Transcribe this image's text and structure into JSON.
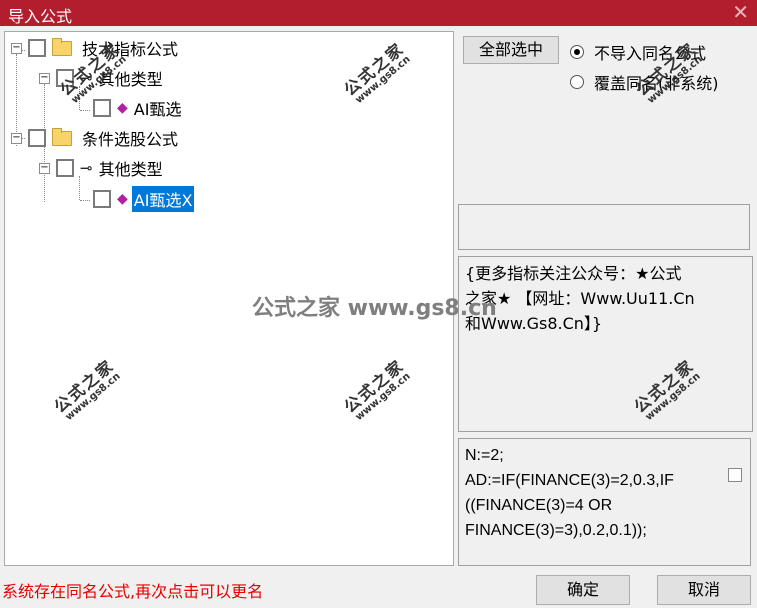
{
  "window": {
    "title": "导入公式",
    "close_glyph": "✕"
  },
  "tree": {
    "n1": "技术指标公式",
    "n2": "其他类型",
    "n3": "AI甄选",
    "n4": "条件选股公式",
    "n5": "其他类型",
    "n6": "AI甄选X",
    "expanded_glyph": "−"
  },
  "controls": {
    "select_all": "全部选中",
    "radio_skip": "不导入同名公式",
    "radio_overwrite": "覆盖同名(非系统)",
    "radio_selected": "skip"
  },
  "description": [
    "{更多指标关注公众号：★公式",
    "之家★ 【网址：Www.Uu11.Cn",
    "和Www.Gs8.Cn】}"
  ],
  "code": [
    "N:=2;",
    "AD:=IF(FINANCE(3)=2,0.3,IF",
    "((FINANCE(3)=4 OR",
    "FINANCE(3)=3),0.2,0.1));"
  ],
  "status_message": "系统存在同名公式,再次点击可以更名",
  "buttons": {
    "ok": "确定",
    "cancel": "取消"
  },
  "watermark": {
    "main": "公式之家 www.gs8.cn",
    "small_text": "公式之家",
    "small_url": "www.gs8.cn"
  }
}
